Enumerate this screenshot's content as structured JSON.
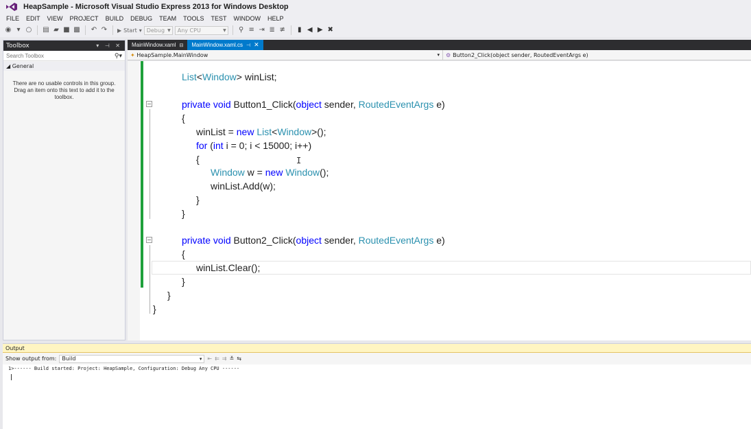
{
  "window": {
    "title": "HeapSample - Microsoft Visual Studio Express 2013 for Windows Desktop"
  },
  "menu": [
    "FILE",
    "EDIT",
    "VIEW",
    "PROJECT",
    "BUILD",
    "DEBUG",
    "TEAM",
    "TOOLS",
    "TEST",
    "WINDOW",
    "HELP"
  ],
  "toolbar": {
    "start_label": "Start",
    "config": "Debug",
    "platform": "Any CPU"
  },
  "toolbox": {
    "title": "Toolbox",
    "search_placeholder": "Search Toolbox",
    "group": "◢ General",
    "empty_message": "There are no usable controls in this group. Drag an item onto this text to add it to the toolbox."
  },
  "tabs": [
    {
      "label": "MainWindow.xaml",
      "pin": "⊟",
      "active": false
    },
    {
      "label": "MainWindow.xaml.cs",
      "pin": "⊣",
      "close": "✕",
      "active": true
    }
  ],
  "navbar": {
    "left": "HeapSample.MainWindow",
    "right": "Button2_Click(object sender, RoutedEventArgs e)"
  },
  "code": {
    "l1": "winList;",
    "l1_type": "List<Window>",
    "l2_sig": "Button1_Click(",
    "l2_end": " sender, ",
    "l2_tail": " e)",
    "open": "{",
    "close": "}",
    "l3_a": "winList = ",
    "l3_b": "List<Window>();",
    "l4_a": " (",
    "l4_b": " i = 0; i < 15000; i++)",
    "l5_a": " w = ",
    "l5_b": "();",
    "l6": "winList.Add(w);",
    "l7_sig": "Button2_Click(",
    "l8": "winList.Clear();",
    "kw_private": "private",
    "kw_void": "void",
    "kw_object": "object",
    "kw_new": "new",
    "kw_for": "for",
    "kw_int": "int",
    "ty_list": "List",
    "ty_window": "Window",
    "ty_routed": "RoutedEventArgs"
  },
  "output": {
    "title": "Output",
    "show_from_label": "Show output from:",
    "source": "Build",
    "log": "1>------ Build started: Project: HeapSample, Configuration: Debug Any CPU ------"
  },
  "icons": {
    "vs_logo": "visual-studio-logo",
    "search": "search-icon",
    "collapse": "collapse-icon"
  },
  "colors": {
    "keyword": "#0000ff",
    "type": "#2b91af",
    "accent": "#007acc",
    "changebar": "#1fa03b"
  }
}
